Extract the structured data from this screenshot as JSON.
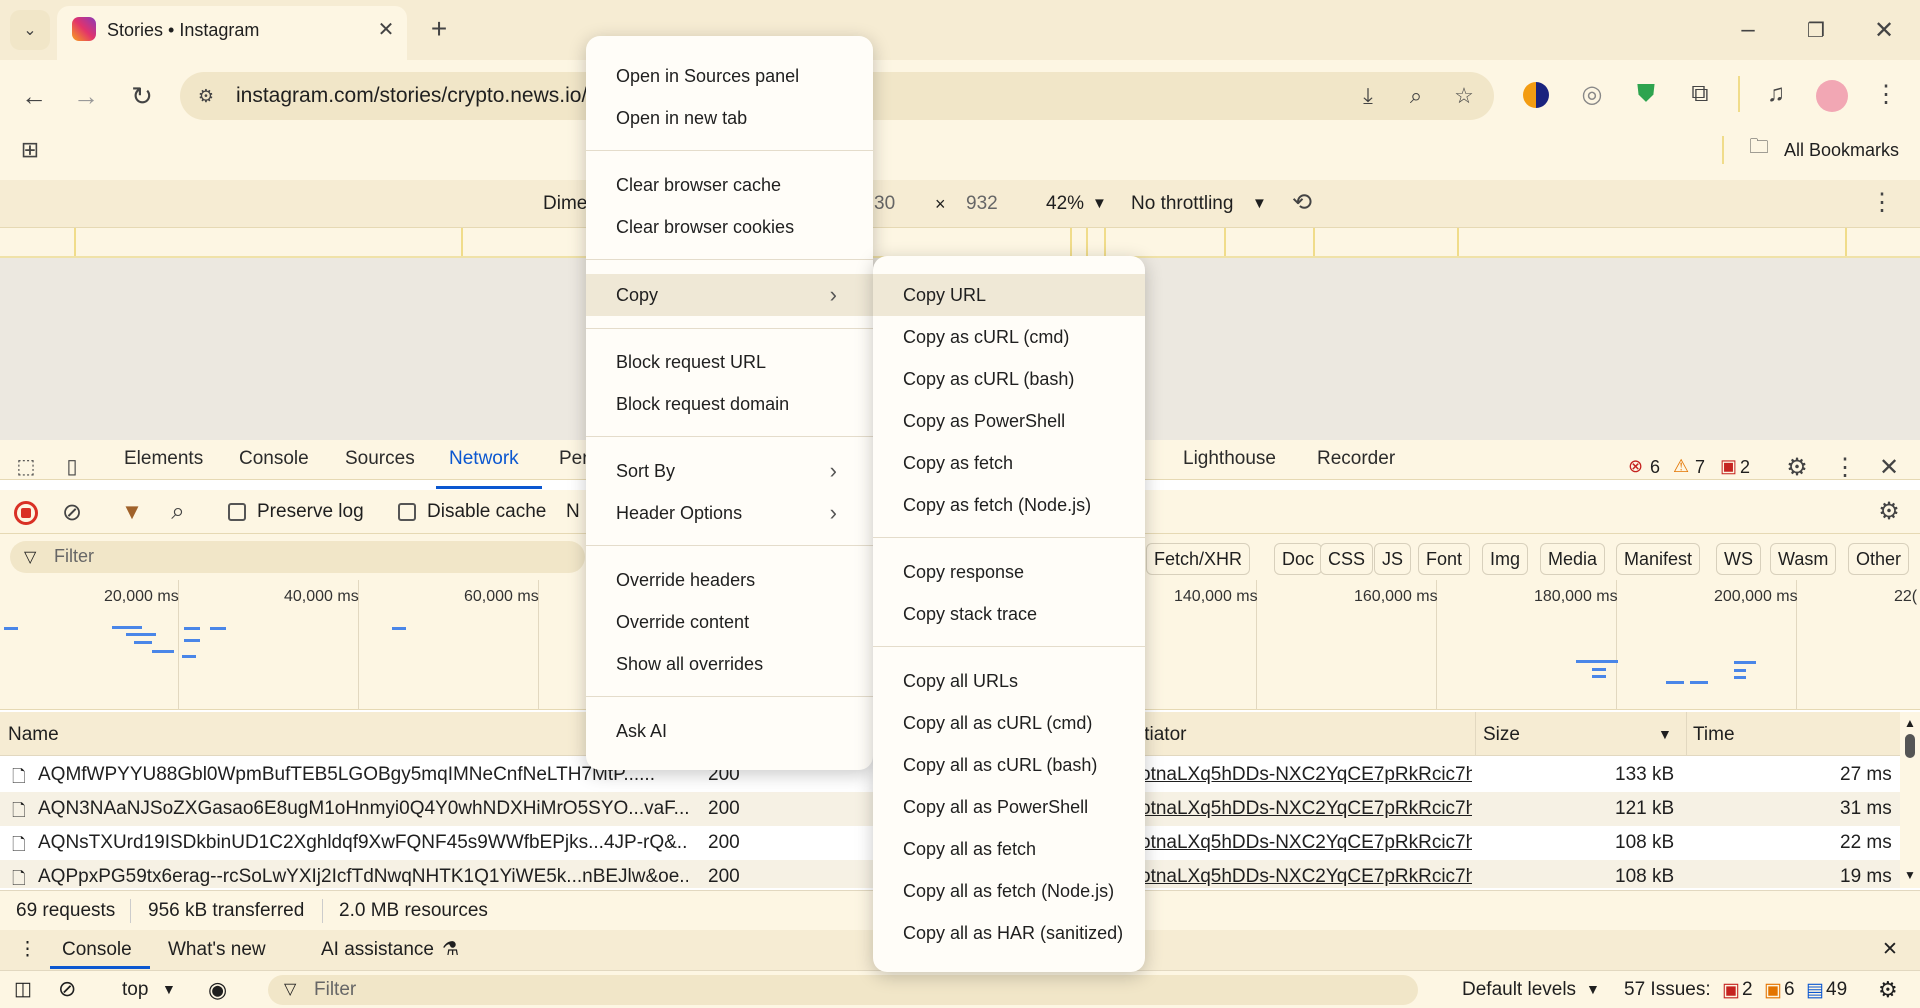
{
  "browser": {
    "tab_title": "Stories • Instagram",
    "url": "instagram.com/stories/crypto.news.io/",
    "bookmarks_label": "All Bookmarks"
  },
  "device_toolbar": {
    "dimensions_label": "Dime",
    "width_fragment": "30",
    "height": "932",
    "zoom": "42%",
    "throttling": "No throttling"
  },
  "devtools": {
    "tabs": [
      "Elements",
      "Console",
      "Sources",
      "Network",
      "Per",
      "Lighthouse",
      "Recorder"
    ],
    "active_tab": "Network",
    "errors": "6",
    "warnings": "7",
    "issues": "2"
  },
  "network": {
    "preserve_log": "Preserve log",
    "disable_cache": "Disable cache",
    "no_fragment": "N",
    "filter_placeholder": "Filter",
    "type_filters": [
      "Fetch/XHR",
      "Doc",
      "CSS",
      "JS",
      "Font",
      "Img",
      "Media",
      "Manifest",
      "WS",
      "Wasm",
      "Other"
    ],
    "timeline_labels": [
      "20,000 ms",
      "40,000 ms",
      "60,000 ms",
      "140,000 ms",
      "160,000 ms",
      "180,000 ms",
      "200,000 ms",
      "22("
    ],
    "columns": {
      "name": "Name",
      "initiator": "itiator",
      "size": "Size",
      "time": "Time"
    },
    "rows": [
      {
        "name": "AQMfWPYYU88Gbl0WpmBufTEB5LGOBgy5mqIMNeCnfNeLTH7MtP......",
        "status": "200",
        "initiator": "otnaLXq5hDDs-NXC2YqCE7pRkRcic7h",
        "size": "133 kB",
        "time": "27 ms"
      },
      {
        "name": "AQN3NAaNJSoZXGasao6E8ugM1oHnmyi0Q4Y0whNDXHiMrO5SYO...vaF...",
        "status": "200",
        "initiator": "otnaLXq5hDDs-NXC2YqCE7pRkRcic7h",
        "size": "121 kB",
        "time": "31 ms"
      },
      {
        "name": "AQNsTXUrd19ISDkbinUD1C2Xghldqf9XwFQNF45s9WWfbEPjks...4JP-rQ&...",
        "status": "200",
        "initiator": "otnaLXq5hDDs-NXC2YqCE7pRkRcic7h",
        "size": "108 kB",
        "time": "22 ms"
      },
      {
        "name": "AQPpxPG59tx6erag--rcSoLwYXIj2IcfTdNwqNHTK1Q1YiWE5k...nBEJlw&oe...",
        "status": "200",
        "initiator": "otnaLXq5hDDs-NXC2YqCE7pRkRcic7h",
        "size": "108 kB",
        "time": "19 ms"
      }
    ],
    "summary": {
      "requests": "69 requests",
      "transferred": "956 kB transferred",
      "resources": "2.0 MB resources"
    }
  },
  "drawer": {
    "tabs": [
      "Console",
      "What's new",
      "AI assistance"
    ],
    "context": "top",
    "filter_placeholder": "Filter",
    "levels": "Default levels",
    "issues_label": "57 Issues:",
    "issue_err": "2",
    "issue_warn": "6",
    "issue_info": "49"
  },
  "context_menu": {
    "groups": [
      [
        "Open in Sources panel",
        "Open in new tab"
      ],
      [
        "Clear browser cache",
        "Clear browser cookies"
      ],
      [
        "Copy"
      ],
      [
        "Block request URL",
        "Block request domain"
      ],
      [
        "Sort By",
        "Header Options"
      ],
      [
        "Override headers",
        "Override content",
        "Show all overrides"
      ],
      [
        "Ask AI"
      ]
    ]
  },
  "copy_submenu": {
    "groups": [
      [
        "Copy URL",
        "Copy as cURL (cmd)",
        "Copy as cURL (bash)",
        "Copy as PowerShell",
        "Copy as fetch",
        "Copy as fetch (Node.js)"
      ],
      [
        "Copy response",
        "Copy stack trace"
      ],
      [
        "Copy all URLs",
        "Copy all as cURL (cmd)",
        "Copy all as cURL (bash)",
        "Copy all as PowerShell",
        "Copy all as fetch",
        "Copy all as fetch (Node.js)",
        "Copy all as HAR (sanitized)"
      ]
    ]
  }
}
